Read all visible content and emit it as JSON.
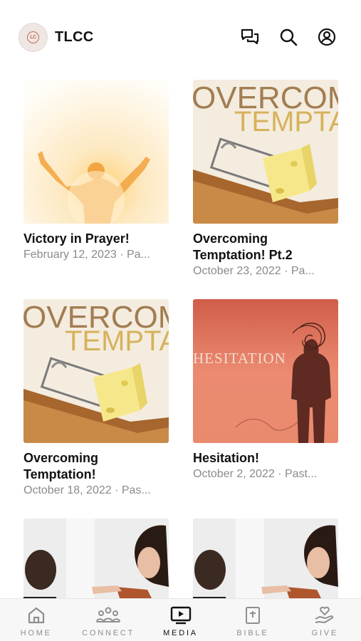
{
  "status": {
    "time": ""
  },
  "header": {
    "logo_text": "LC",
    "title": "TLCC",
    "icons": [
      "chat-icon",
      "search-icon",
      "account-icon"
    ]
  },
  "sermons": [
    {
      "title": "Victory in Prayer!",
      "meta": "February 12, 2023 · Pa...",
      "image": "praise"
    },
    {
      "title": "Overcoming Temptation! Pt.2",
      "meta": "October 23, 2022 · Pa...",
      "image": "temptation",
      "image_text_1": "OVERCOM",
      "image_text_2": "TEMPTA"
    },
    {
      "title": "Overcoming Temptation!",
      "meta": "October 18, 2022 · Pas...",
      "image": "temptation",
      "image_text_1": "OVERCOM",
      "image_text_2": "TEMPTA"
    },
    {
      "title": "Hesitation!",
      "meta": "October 2, 2022 · Past...",
      "image": "hesitation",
      "image_text_1": "HESITATION"
    },
    {
      "title": "",
      "meta": "",
      "image": "argument"
    },
    {
      "title": "",
      "meta": "",
      "image": "argument"
    }
  ],
  "tabbar": {
    "items": [
      {
        "label": "HOME",
        "icon": "home-icon"
      },
      {
        "label": "CONNECT",
        "icon": "people-icon"
      },
      {
        "label": "MEDIA",
        "icon": "media-play-icon",
        "active": true
      },
      {
        "label": "BIBLE",
        "icon": "bible-icon"
      },
      {
        "label": "GIVE",
        "icon": "give-hand-icon"
      }
    ]
  },
  "colors": {
    "accent": "#111111",
    "inactive": "#8e8e8e",
    "meta": "#8a8a8a"
  }
}
